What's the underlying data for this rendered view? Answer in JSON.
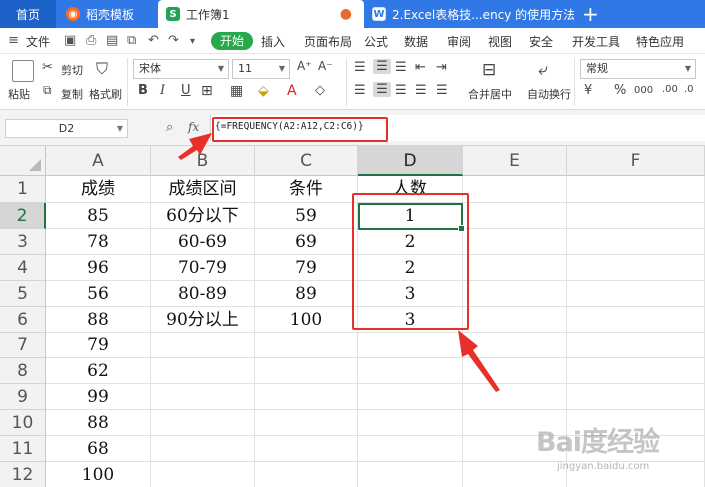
{
  "tabs": {
    "home": "首页",
    "daoke": "稻壳模板",
    "active": "工作簿1",
    "doc2": "2.Excel表格技...ency 的使用方法",
    "new_tab": "+",
    "sheet_icon_letter": "S",
    "doc2_icon_letter": "W"
  },
  "menu": {
    "file": "文件",
    "start": "开始",
    "items": [
      "插入",
      "页面布局",
      "公式",
      "数据",
      "审阅",
      "视图",
      "安全",
      "开发工具",
      "特色应用"
    ]
  },
  "ribbon": {
    "paste": "粘贴",
    "cut": "剪切",
    "copy": "复制",
    "format_painter": "格式刷",
    "font_name": "宋体",
    "font_size": "11",
    "merge_center": "合并居中",
    "wrap_text": "自动换行",
    "number_format": "常规",
    "percent": "%",
    "bold": "B",
    "italic": "I",
    "underline": "U",
    "grow_font": "A⁺",
    "shrink_font": "A⁻"
  },
  "formula_bar": {
    "cell_ref": "D2",
    "fx": "fx",
    "formula": "{=FREQUENCY(A2:A12,C2:C6)}"
  },
  "sheet": {
    "columns": [
      "A",
      "B",
      "C",
      "D",
      "E",
      "F"
    ],
    "selected_column": "D",
    "selected_row": 2,
    "rows": [
      {
        "num": "1",
        "cells": [
          "成绩",
          "成绩区间",
          "条件",
          "人数",
          "",
          ""
        ]
      },
      {
        "num": "2",
        "cells": [
          "85",
          "60分以下",
          "59",
          "1",
          "",
          ""
        ]
      },
      {
        "num": "3",
        "cells": [
          "78",
          "60-69",
          "69",
          "2",
          "",
          ""
        ]
      },
      {
        "num": "4",
        "cells": [
          "96",
          "70-79",
          "79",
          "2",
          "",
          ""
        ]
      },
      {
        "num": "5",
        "cells": [
          "56",
          "80-89",
          "89",
          "3",
          "",
          ""
        ]
      },
      {
        "num": "6",
        "cells": [
          "88",
          "90分以上",
          "100",
          "3",
          "",
          ""
        ]
      },
      {
        "num": "7",
        "cells": [
          "79",
          "",
          "",
          "",
          "",
          ""
        ]
      },
      {
        "num": "8",
        "cells": [
          "62",
          "",
          "",
          "",
          "",
          ""
        ]
      },
      {
        "num": "9",
        "cells": [
          "99",
          "",
          "",
          "",
          "",
          ""
        ]
      },
      {
        "num": "10",
        "cells": [
          "88",
          "",
          "",
          "",
          "",
          ""
        ]
      },
      {
        "num": "11",
        "cells": [
          "68",
          "",
          "",
          "",
          "",
          ""
        ]
      },
      {
        "num": "12",
        "cells": [
          "100",
          "",
          "",
          "",
          "",
          ""
        ]
      }
    ]
  },
  "annotations": {
    "highlight_color": "#e8302a",
    "selection_color": "#217346"
  },
  "watermark": {
    "logo": "Bai度经验",
    "url": "jingyan.baidu.com"
  }
}
